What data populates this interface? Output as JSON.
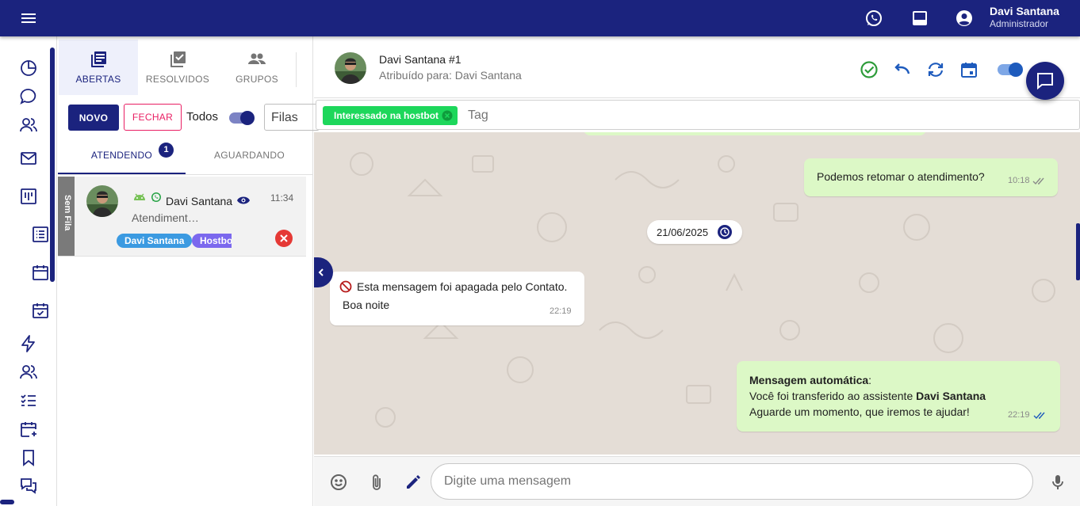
{
  "user": {
    "name": "Davi Santana",
    "role": "Administrador"
  },
  "topbar_icons": [
    "menu-icon",
    "whatsapp-icon",
    "inbox-icon",
    "account-icon"
  ],
  "rail_icons": [
    "dashboard-icon",
    "chat-icon",
    "contacts-icon",
    "mail-icon",
    "kanban-icon",
    "list-icon",
    "calendar-icon",
    "calendar-check-icon",
    "bolt-icon",
    "users-icon",
    "checklist-icon",
    "calendar-add-icon",
    "bookmark-icon",
    "forum-icon"
  ],
  "tabs": [
    {
      "label": "ABERTAS",
      "icon": "inbox-stack-icon",
      "active": true
    },
    {
      "label": "RESOLVIDOS",
      "icon": "check-box-icon",
      "active": false
    },
    {
      "label": "GRUPOS",
      "icon": "group-icon",
      "active": false
    }
  ],
  "toolbar": {
    "novo_label": "NOVO",
    "fechar_label": "FECHAR",
    "todos_label": "Todos",
    "todos_on": true,
    "filas_label": "Filas"
  },
  "subtabs": [
    {
      "label": "ATENDENDO",
      "badge": "1",
      "active": true
    },
    {
      "label": "AGUARDANDO",
      "active": false
    }
  ],
  "ticket": {
    "queue": "Sem Fila",
    "name": "Davi Santana",
    "time": "11:34",
    "last_message": "Atendiment…",
    "tags": [
      {
        "label": "Davi Santana",
        "color": "#3b9ae1"
      },
      {
        "label": "Hostbo",
        "color": "#7b68ee"
      }
    ]
  },
  "chat": {
    "title": "Davi Santana #1",
    "assigned": "Atribuído para: Davi Santana",
    "tags": [
      {
        "label": "Interessado na hostbot",
        "color": "#1dd75b"
      }
    ],
    "tag_placeholder": "Tag",
    "input_placeholder": "Digite uma mensagem"
  },
  "messages": [
    {
      "direction": "out",
      "text": "Podemos retomar o atendimento?",
      "time": "10:18"
    },
    {
      "type": "date",
      "text": "21/06/2025"
    },
    {
      "direction": "in",
      "deleted_text": "Esta mensagem foi apagada pelo Contato.",
      "text": "Boa noite",
      "time": "22:19"
    },
    {
      "direction": "out",
      "bold_prefix": "Mensagem automática",
      "prefix_suffix": ":",
      "line2_pre": "Você foi transferido ao assistente ",
      "line2_bold": "Davi Santana",
      "line3": "Aguarde um momento, que iremos te ajudar!",
      "time": "22:19"
    }
  ],
  "colors": {
    "primary": "#1b237e",
    "out_bubble": "#dcf8c6",
    "chat_bg": "#e4ddd6",
    "danger": "#e53935",
    "success": "#2e7d32"
  }
}
